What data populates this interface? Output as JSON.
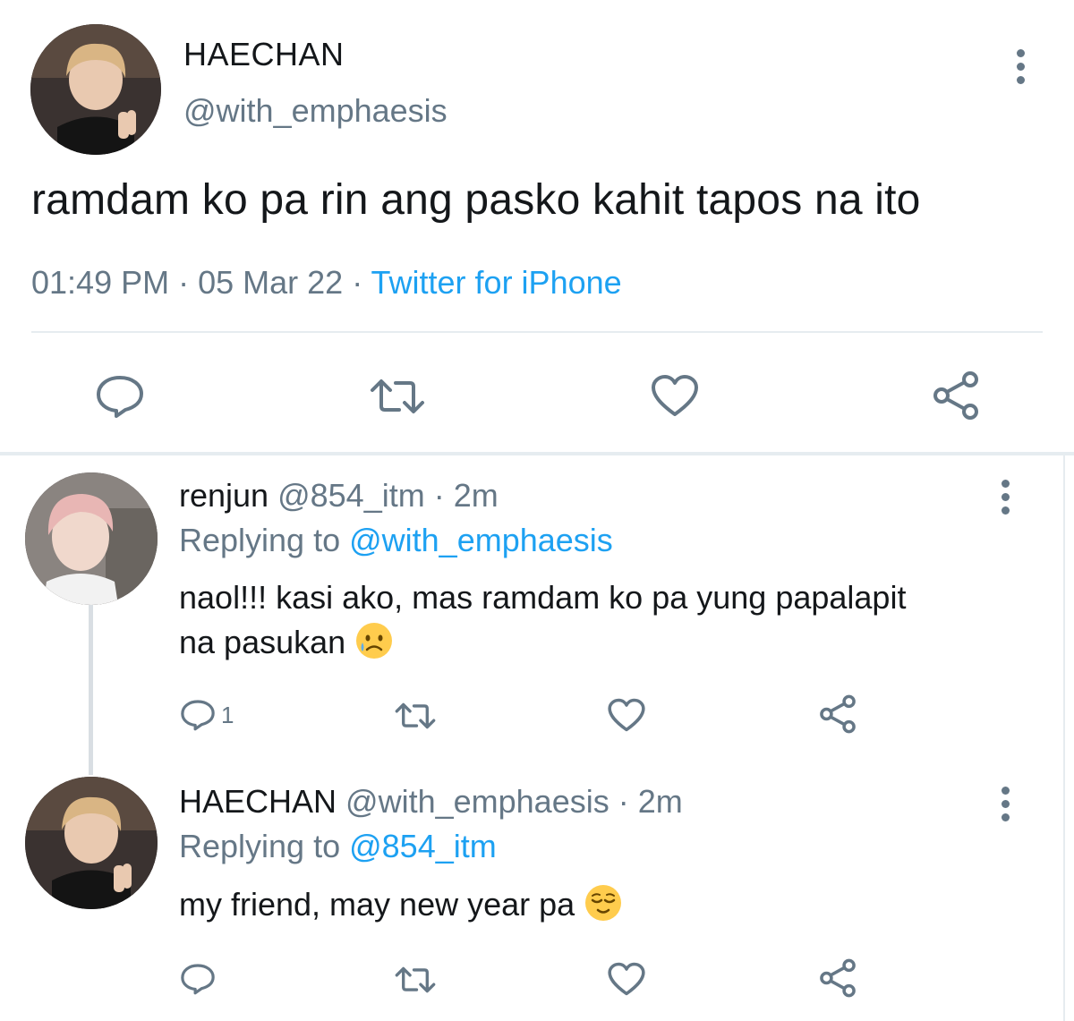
{
  "main_tweet": {
    "author_name": "HAECHAN",
    "author_handle": "@with_emphaesis",
    "text": "ramdam ko pa rin ang pasko kahit tapos na ito",
    "time": "01:49 PM",
    "sep1": " · ",
    "date": "05 Mar 22",
    "sep2": " · ",
    "source": "Twitter for iPhone",
    "actions": [
      "reply-icon",
      "retweet-icon",
      "like-icon",
      "share-icon"
    ]
  },
  "replies": [
    {
      "author_name": "renjun",
      "meta": " @854_itm · 2m",
      "replying_label": "Replying to ",
      "replying_to": "@with_emphaesis",
      "text_line1": "naol!!! kasi ako, mas ramdam ko pa yung papalapit",
      "text_line2": "na pasukan ",
      "emoji": "sad-but-relieved-face",
      "reply_count": "1"
    },
    {
      "author_name": "HAECHAN",
      "meta": " @with_emphaesis · 2m",
      "replying_label": "Replying to ",
      "replying_to": "@854_itm",
      "text": "my friend, may new year pa ",
      "emoji": "relieved-face"
    }
  ],
  "colors": {
    "text": "#14171a",
    "secondary": "#657786",
    "link": "#1da1f2",
    "divider": "#e6ecf0"
  }
}
